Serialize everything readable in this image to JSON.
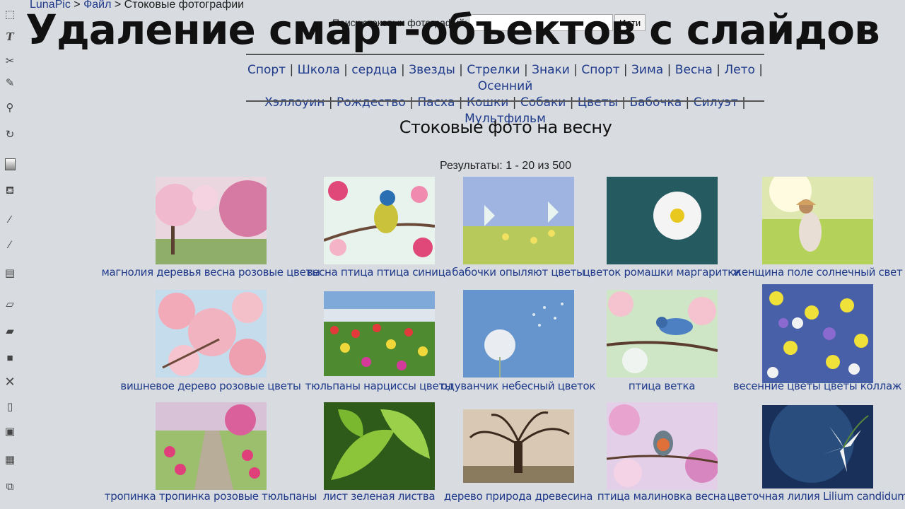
{
  "breadcrumb": {
    "home": "LunaPic",
    "sep1": " > ",
    "file": "Файл",
    "sep2": " > ",
    "current": "Стоковые фотографии"
  },
  "search": {
    "label": "Поиск стоковых фотографий:",
    "value": "",
    "button": "Идти"
  },
  "headline": "Удаление смарт-объектов с слайдов",
  "categories_row1": [
    "Спорт",
    "Школа",
    "сердца",
    "Звезды",
    "Стрелки",
    "Знаки",
    "Спорт",
    "Зима",
    "Весна",
    "Лето",
    "Осенний"
  ],
  "categories_row2": [
    "Хэллоуин",
    "Рождество",
    "Пасха",
    "Кошки",
    "Собаки",
    "Цветы",
    "Бабочка",
    "Силуэт",
    "Мультфильм"
  ],
  "section_title": "Стоковые фото на весну",
  "results": "Результаты: 1 - 20 из 500",
  "photos": [
    {
      "caption": "магнолия деревья весна розовые цветы"
    },
    {
      "caption": "весна птица птица синица"
    },
    {
      "caption": "бабочки опыляют цветы"
    },
    {
      "caption": "цветок ромашки маргаритки"
    },
    {
      "caption": "женщина поле солнечный свет"
    },
    {
      "caption": "вишневое дерево розовые цветы"
    },
    {
      "caption": "тюльпаны нарциссы цветы"
    },
    {
      "caption": "одуванчик небесный цветок"
    },
    {
      "caption": "птица ветка"
    },
    {
      "caption": "весенние цветы цветы коллаж"
    },
    {
      "caption": "тропинка тропинка розовые тюльпаны"
    },
    {
      "caption": "лист зеленая листва"
    },
    {
      "caption": "дерево природа древесина"
    },
    {
      "caption": "птица малиновка весна"
    },
    {
      "caption": "цветочная лилия Lilium candidum"
    }
  ],
  "toolbar_icons": [
    "select-icon",
    "text-icon",
    "scissors-icon",
    "pencil-icon",
    "zoom-icon",
    "rotate-icon",
    "gradient-icon",
    "paint-bucket-icon",
    "eyedropper-icon",
    "brush-icon",
    "layers-icon",
    "eraser-icon",
    "open-folder-icon",
    "save-icon",
    "close-icon",
    "new-file-icon",
    "print-icon",
    "paste-icon",
    "copy-icon"
  ]
}
